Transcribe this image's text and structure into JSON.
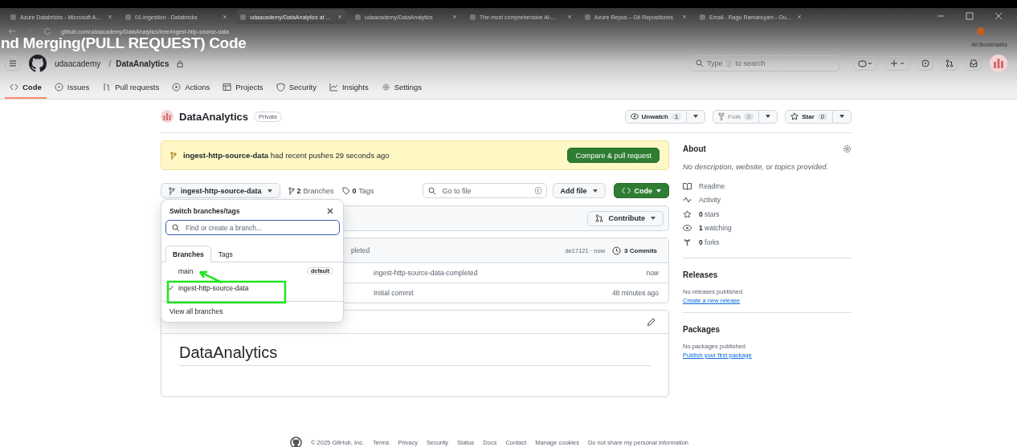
{
  "browser": {
    "tabs": [
      {
        "title": "Azure Databricks - Microsoft A...",
        "selected": false
      },
      {
        "title": "01-Ingestion - Databricks",
        "selected": false
      },
      {
        "title": "udaacademy/DataAnalytics at ...",
        "selected": true
      },
      {
        "title": "udaacademy/DataAnalytics",
        "selected": false
      },
      {
        "title": "The most comprehensive AI-...",
        "selected": false
      },
      {
        "title": "Azure Repos – Git Repositories",
        "selected": false
      },
      {
        "title": "Email - Ragu Ramanujam - Ou...",
        "selected": false
      }
    ],
    "address": "github.com/udaacademy/DataAnalytics/tree/ingest-http-source-data",
    "bookmarks": "All Bookmarks"
  },
  "video_caption": "nd Merging(PULL REQUEST) Code",
  "header": {
    "owner": "udaacademy",
    "separator": "/",
    "repo": "DataAnalytics",
    "search": {
      "before": "Type",
      "key": "/",
      "after": "to search"
    }
  },
  "nav": [
    {
      "label": "Code",
      "selected": true
    },
    {
      "label": "Issues",
      "selected": false
    },
    {
      "label": "Pull requests",
      "selected": false
    },
    {
      "label": "Actions",
      "selected": false
    },
    {
      "label": "Projects",
      "selected": false
    },
    {
      "label": "Security",
      "selected": false
    },
    {
      "label": "Insights",
      "selected": false
    },
    {
      "label": "Settings",
      "selected": false
    }
  ],
  "repo": {
    "name": "DataAnalytics",
    "visibility": "Private",
    "watch": {
      "label": "Unwatch",
      "count": "1"
    },
    "fork": {
      "label": "Fork",
      "count": "0"
    },
    "star": {
      "label": "Star",
      "count": "0"
    }
  },
  "banner": {
    "branch": "ingest-http-source-data",
    "text": "had recent pushes 29 seconds ago",
    "button": "Compare & pull request"
  },
  "toolbar": {
    "branch": "ingest-http-source-data",
    "branches": {
      "count": "2",
      "label": "Branches"
    },
    "tags": {
      "count": "0",
      "label": "Tags"
    },
    "go_to_file": "Go to file",
    "shortcut": "t",
    "add_file": "Add file",
    "code": "Code"
  },
  "contribute": "Contribute",
  "commit_header": {
    "message": "pleted",
    "hash": "de17121 · now",
    "commits": "3 Commits"
  },
  "files": [
    {
      "message": "ingest-http-source-data-completed",
      "time": "now"
    },
    {
      "message": "Initial commit",
      "time": "48 minutes ago"
    }
  ],
  "readme": {
    "title": "DataAnalytics"
  },
  "dropdown": {
    "title": "Switch branches/tags",
    "placeholder": "Find or create a branch...",
    "tabs": [
      {
        "label": "Branches",
        "selected": true
      },
      {
        "label": "Tags",
        "selected": false
      }
    ],
    "branches": [
      {
        "name": "main",
        "checked": false,
        "badge": "default"
      },
      {
        "name": "ingest-http-source-data",
        "checked": true
      }
    ],
    "footer": "View all branches"
  },
  "about": {
    "title": "About",
    "description": "No description, website, or topics provided.",
    "items": [
      {
        "kind": "readme",
        "text": "Readme"
      },
      {
        "kind": "activity",
        "text": "Activity"
      },
      {
        "kind": "stars",
        "text": "**0** stars"
      },
      {
        "kind": "watching",
        "text": "**1** watching"
      },
      {
        "kind": "forks",
        "text": "**0** forks"
      }
    ]
  },
  "releases": {
    "title": "Releases",
    "note": "No releases published",
    "link": "Create a new release"
  },
  "packages": {
    "title": "Packages",
    "note": "No packages published",
    "link": "Publish your first package"
  },
  "footer": {
    "copyright": "© 2025 GitHub, Inc.",
    "links": [
      "Terms",
      "Privacy",
      "Security",
      "Status",
      "Docs",
      "Contact",
      "Manage cookies",
      "Do not share my personal information"
    ]
  }
}
